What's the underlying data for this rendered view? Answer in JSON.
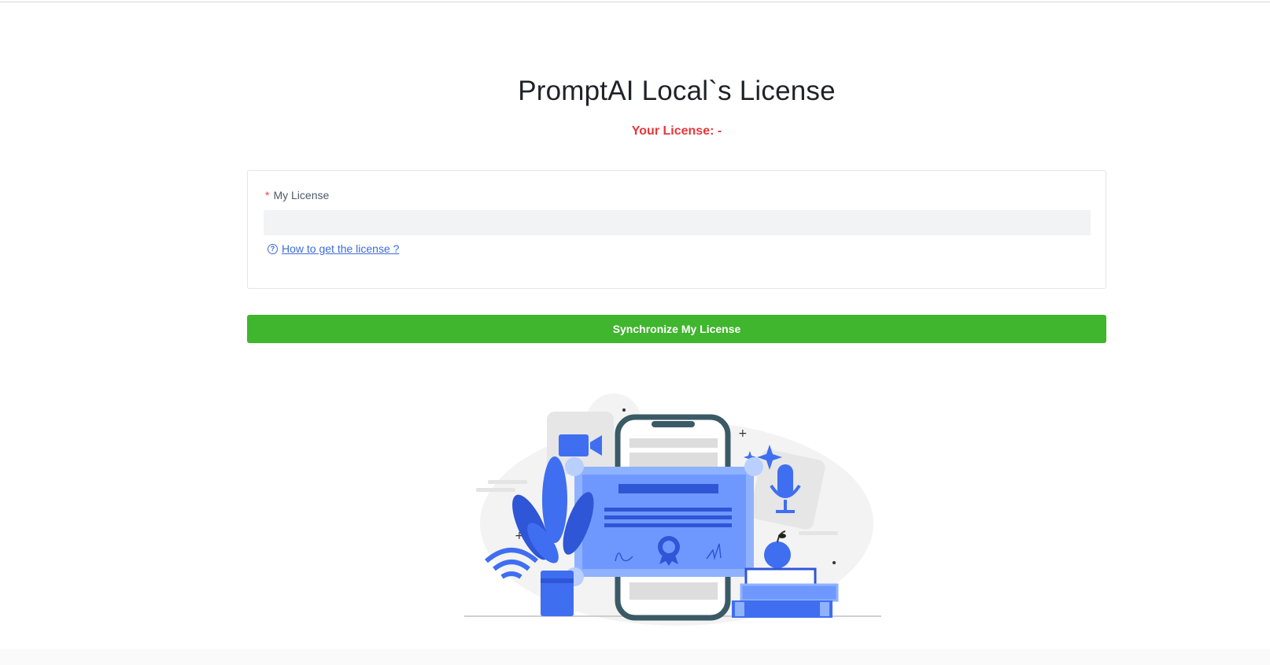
{
  "page": {
    "title": "PromptAI Local`s License",
    "license_status": "Your License: -"
  },
  "form": {
    "field_label": "My License",
    "required_mark": "*",
    "license_value": "",
    "license_placeholder": "",
    "help_icon_glyph": "?",
    "help_link_text": "How to get the license ?"
  },
  "actions": {
    "sync_button_label": "Synchronize My License"
  },
  "icons": {
    "help": "question-circle-icon",
    "illustration": "license-certificate-illustration"
  },
  "colors": {
    "accent_green": "#40b52e",
    "status_red": "#e5383b",
    "link_blue": "#3c6bd6",
    "illustration_blue": "#3f6ef0"
  }
}
